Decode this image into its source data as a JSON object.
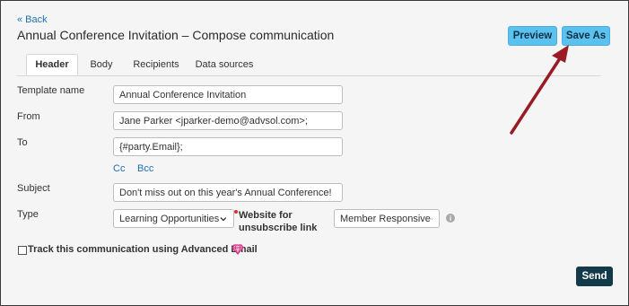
{
  "header": {
    "back_label": "« Back",
    "title": "Annual Conference Invitation – Compose communication",
    "preview_label": "Preview",
    "save_as_label": "Save As"
  },
  "tabs": [
    {
      "label": "Header",
      "active": true
    },
    {
      "label": "Body",
      "active": false
    },
    {
      "label": "Recipients",
      "active": false
    },
    {
      "label": "Data sources",
      "active": false
    }
  ],
  "form": {
    "template_name_label": "Template name",
    "template_name_value": "Annual Conference Invitation",
    "from_label": "From",
    "from_value": "Jane Parker <jparker-demo@advsol.com>;",
    "to_label": "To",
    "to_value": "{#party.Email};",
    "cc_label": "Cc",
    "bcc_label": "Bcc",
    "subject_label": "Subject",
    "subject_value": "Don't miss out on this year's Annual Conference!",
    "type_label": "Type",
    "type_value": "Learning Opportunities",
    "website_label_line1": "Website for",
    "website_label_line2": "unsubscribe link",
    "website_value": "Member Responsive",
    "track_label": "Track this communication using Advanced Email"
  },
  "footer": {
    "send_label": "Send"
  },
  "colors": {
    "accent_button": "#5bc2ef",
    "send_button": "#123a48",
    "link": "#1f6fb2",
    "arrow": "#9b1b24",
    "gem": "#d63384"
  }
}
